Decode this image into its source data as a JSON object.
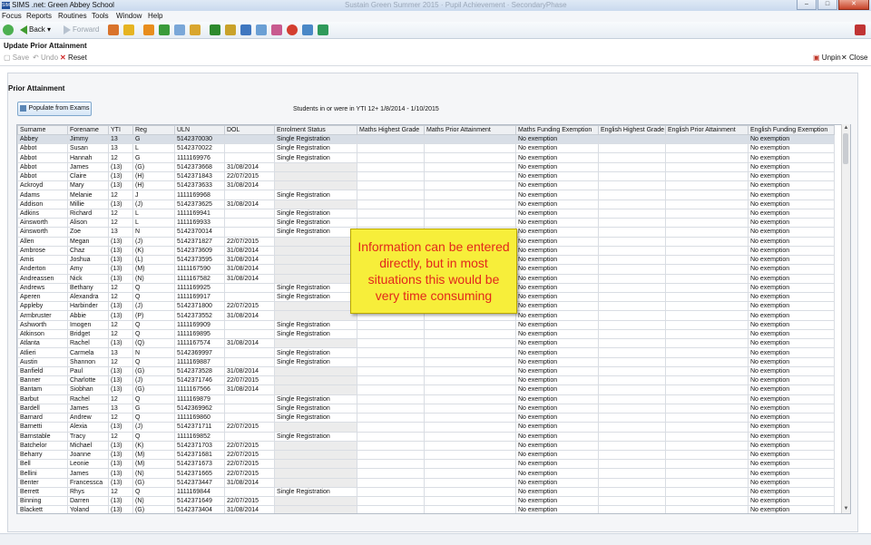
{
  "window": {
    "app_icon_text": "SIMS",
    "title": "SIMS .net: Green Abbey School",
    "ghost_title": "Sustain Green Summer 2015 · Pupil Achievement · SecondaryPhase",
    "min": "–",
    "max": "□",
    "close": "✕"
  },
  "menu": [
    "Focus",
    "Reports",
    "Routines",
    "Tools",
    "Window",
    "Help"
  ],
  "toolbar": {
    "back": "Back",
    "forward": "Forward"
  },
  "panel_title": "Update Prior Attainment",
  "actions": {
    "save": "Save",
    "undo": "Undo",
    "reset": "Reset",
    "unpin": "Unpin",
    "close": "Close"
  },
  "section": {
    "label": "Prior Attainment",
    "populate_button": "Populate from Exams",
    "students_label": "Students in or were in YTI 12+ 1/8/2014 - 1/10/2015"
  },
  "table": {
    "columns": [
      "Surname",
      "Forename",
      "YTI",
      "Reg",
      "ULN",
      "DOL",
      "Enrolment Status",
      "Maths Highest Grade",
      "Maths Prior Attainment",
      "Maths Funding Exemption",
      "English Highest Grade",
      "English Prior Attainment",
      "English Funding Exemption"
    ],
    "rows": [
      [
        "Abbey",
        "Jimmy",
        "13",
        "G",
        "5142370030",
        "",
        "Single Registration",
        "",
        "",
        "No exemption",
        "",
        "",
        "No exemption"
      ],
      [
        "Abbot",
        "Susan",
        "13",
        "L",
        "5142370022",
        "",
        "Single Registration",
        "",
        "",
        "No exemption",
        "",
        "",
        "No exemption"
      ],
      [
        "Abbot",
        "Hannah",
        "12",
        "G",
        "1111169976",
        "",
        "Single Registration",
        "",
        "",
        "No exemption",
        "",
        "",
        "No exemption"
      ],
      [
        "Abbot",
        "James",
        "(13)",
        "(G)",
        "5142373668",
        "31/08/2014",
        "",
        "",
        "",
        "No exemption",
        "",
        "",
        "No exemption"
      ],
      [
        "Abbot",
        "Claire",
        "(13)",
        "(H)",
        "5142371843",
        "22/07/2015",
        "",
        "",
        "",
        "No exemption",
        "",
        "",
        "No exemption"
      ],
      [
        "Ackroyd",
        "Mary",
        "(13)",
        "(H)",
        "5142373633",
        "31/08/2014",
        "",
        "",
        "",
        "No exemption",
        "",
        "",
        "No exemption"
      ],
      [
        "Adams",
        "Melanie",
        "12",
        "J",
        "1111169968",
        "",
        "Single Registration",
        "",
        "",
        "No exemption",
        "",
        "",
        "No exemption"
      ],
      [
        "Addison",
        "Millie",
        "(13)",
        "(J)",
        "5142373625",
        "31/08/2014",
        "",
        "",
        "",
        "No exemption",
        "",
        "",
        "No exemption"
      ],
      [
        "Adkins",
        "Richard",
        "12",
        "L",
        "1111169941",
        "",
        "Single Registration",
        "",
        "",
        "No exemption",
        "",
        "",
        "No exemption"
      ],
      [
        "Ainsworth",
        "Alison",
        "12",
        "L",
        "1111169933",
        "",
        "Single Registration",
        "",
        "",
        "No exemption",
        "",
        "",
        "No exemption"
      ],
      [
        "Ainsworth",
        "Zoe",
        "13",
        "N",
        "5142370014",
        "",
        "Single Registration",
        "",
        "",
        "No exemption",
        "",
        "",
        "No exemption"
      ],
      [
        "Allen",
        "Megan",
        "(13)",
        "(J)",
        "5142371827",
        "22/07/2015",
        "",
        "",
        "",
        "No exemption",
        "",
        "",
        "No exemption"
      ],
      [
        "Ambrose",
        "Chaz",
        "(13)",
        "(K)",
        "5142373609",
        "31/08/2014",
        "",
        "",
        "",
        "No exemption",
        "",
        "",
        "No exemption"
      ],
      [
        "Amis",
        "Joshua",
        "(13)",
        "(L)",
        "5142373595",
        "31/08/2014",
        "",
        "",
        "",
        "No exemption",
        "",
        "",
        "No exemption"
      ],
      [
        "Anderton",
        "Amy",
        "(13)",
        "(M)",
        "1111167590",
        "31/08/2014",
        "",
        "",
        "",
        "No exemption",
        "",
        "",
        "No exemption"
      ],
      [
        "Andreassen",
        "Nick",
        "(13)",
        "(N)",
        "1111167582",
        "31/08/2014",
        "",
        "",
        "",
        "No exemption",
        "",
        "",
        "No exemption"
      ],
      [
        "Andrews",
        "Bethany",
        "12",
        "Q",
        "1111169925",
        "",
        "Single Registration",
        "",
        "",
        "No exemption",
        "",
        "",
        "No exemption"
      ],
      [
        "Aperen",
        "Alexandra",
        "12",
        "Q",
        "1111169917",
        "",
        "Single Registration",
        "",
        "",
        "No exemption",
        "",
        "",
        "No exemption"
      ],
      [
        "Appleby",
        "Harbinder",
        "(13)",
        "(J)",
        "5142371800",
        "22/07/2015",
        "",
        "",
        "",
        "No exemption",
        "",
        "",
        "No exemption"
      ],
      [
        "Armbruster",
        "Abbie",
        "(13)",
        "(P)",
        "5142373552",
        "31/08/2014",
        "",
        "",
        "",
        "No exemption",
        "",
        "",
        "No exemption"
      ],
      [
        "Ashworth",
        "Imogen",
        "12",
        "Q",
        "1111169909",
        "",
        "Single Registration",
        "",
        "",
        "No exemption",
        "",
        "",
        "No exemption"
      ],
      [
        "Atkinson",
        "Bridget",
        "12",
        "Q",
        "1111169895",
        "",
        "Single Registration",
        "",
        "",
        "No exemption",
        "",
        "",
        "No exemption"
      ],
      [
        "Atlanta",
        "Rachel",
        "(13)",
        "(Q)",
        "1111167574",
        "31/08/2014",
        "",
        "",
        "",
        "No exemption",
        "",
        "",
        "No exemption"
      ],
      [
        "Atlieri",
        "Carmela",
        "13",
        "N",
        "5142369997",
        "",
        "Single Registration",
        "",
        "",
        "No exemption",
        "",
        "",
        "No exemption"
      ],
      [
        "Austin",
        "Shannon",
        "12",
        "Q",
        "1111169887",
        "",
        "Single Registration",
        "",
        "",
        "No exemption",
        "",
        "",
        "No exemption"
      ],
      [
        "Banfield",
        "Paul",
        "(13)",
        "(G)",
        "5142373528",
        "31/08/2014",
        "",
        "",
        "",
        "No exemption",
        "",
        "",
        "No exemption"
      ],
      [
        "Banner",
        "Charlotte",
        "(13)",
        "(J)",
        "5142371746",
        "22/07/2015",
        "",
        "",
        "",
        "No exemption",
        "",
        "",
        "No exemption"
      ],
      [
        "Bantam",
        "Siobhan",
        "(13)",
        "(G)",
        "1111167566",
        "31/08/2014",
        "",
        "",
        "",
        "No exemption",
        "",
        "",
        "No exemption"
      ],
      [
        "Barbut",
        "Rachel",
        "12",
        "Q",
        "1111169879",
        "",
        "Single Registration",
        "",
        "",
        "No exemption",
        "",
        "",
        "No exemption"
      ],
      [
        "Bardell",
        "James",
        "13",
        "G",
        "5142369962",
        "",
        "Single Registration",
        "",
        "",
        "No exemption",
        "",
        "",
        "No exemption"
      ],
      [
        "Barnard",
        "Andrew",
        "12",
        "Q",
        "1111169860",
        "",
        "Single Registration",
        "",
        "",
        "No exemption",
        "",
        "",
        "No exemption"
      ],
      [
        "Barnetti",
        "Alexia",
        "(13)",
        "(J)",
        "5142371711",
        "22/07/2015",
        "",
        "",
        "",
        "No exemption",
        "",
        "",
        "No exemption"
      ],
      [
        "Barnstable",
        "Tracy",
        "12",
        "Q",
        "1111169852",
        "",
        "Single Registration",
        "",
        "",
        "No exemption",
        "",
        "",
        "No exemption"
      ],
      [
        "Batchelor",
        "Michael",
        "(13)",
        "(K)",
        "5142371703",
        "22/07/2015",
        "",
        "",
        "",
        "No exemption",
        "",
        "",
        "No exemption"
      ],
      [
        "Beharry",
        "Joanne",
        "(13)",
        "(M)",
        "5142371681",
        "22/07/2015",
        "",
        "",
        "",
        "No exemption",
        "",
        "",
        "No exemption"
      ],
      [
        "Bell",
        "Leonie",
        "(13)",
        "(M)",
        "5142371673",
        "22/07/2015",
        "",
        "",
        "",
        "No exemption",
        "",
        "",
        "No exemption"
      ],
      [
        "Bellini",
        "James",
        "(13)",
        "(N)",
        "5142371665",
        "22/07/2015",
        "",
        "",
        "",
        "No exemption",
        "",
        "",
        "No exemption"
      ],
      [
        "Benter",
        "Francessca",
        "(13)",
        "(G)",
        "5142373447",
        "31/08/2014",
        "",
        "",
        "",
        "No exemption",
        "",
        "",
        "No exemption"
      ],
      [
        "Berrett",
        "Rhys",
        "12",
        "Q",
        "1111169844",
        "",
        "Single Registration",
        "",
        "",
        "No exemption",
        "",
        "",
        "No exemption"
      ],
      [
        "Binning",
        "Darren",
        "(13)",
        "(N)",
        "5142371649",
        "22/07/2015",
        "",
        "",
        "",
        "No exemption",
        "",
        "",
        "No exemption"
      ],
      [
        "Blackett",
        "Yoland",
        "(13)",
        "(G)",
        "5142373404",
        "31/08/2014",
        "",
        "",
        "",
        "No exemption",
        "",
        "",
        "No exemption"
      ]
    ]
  },
  "callout": "Information can be entered directly, but in most situations this would be very time consuming"
}
